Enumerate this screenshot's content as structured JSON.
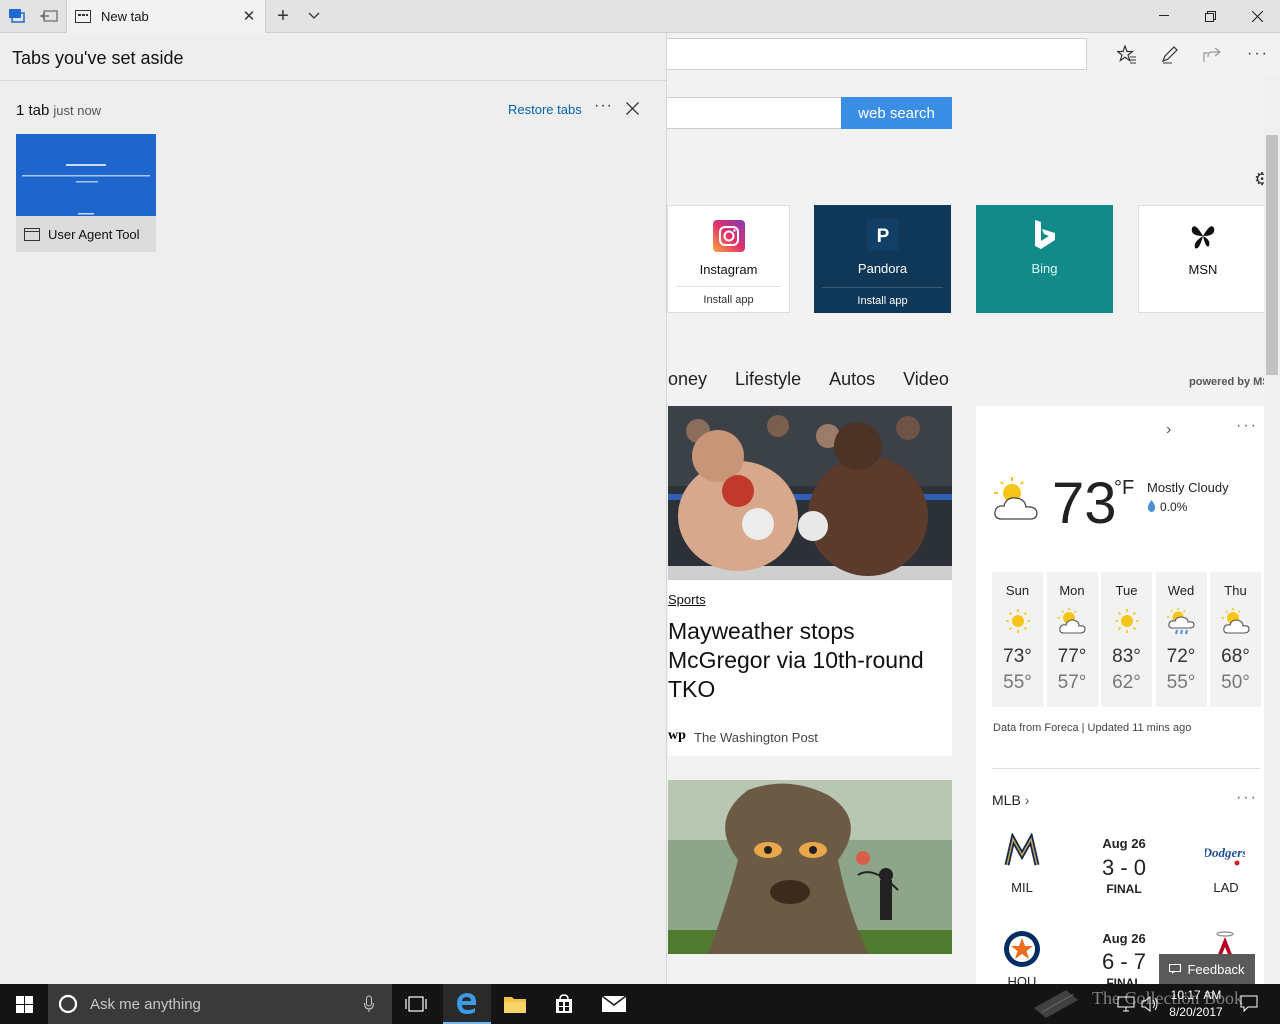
{
  "titlebar": {
    "tab_title": "New tab"
  },
  "aside": {
    "title": "Tabs you've set aside",
    "group_count": "1 tab",
    "group_time": "just now",
    "restore_label": "Restore tabs",
    "thumbnail_title": "User Agent Tool"
  },
  "page": {
    "search_button": "web search",
    "tiles": [
      {
        "name": "Instagram",
        "sub": "Install app",
        "icon": "instagram-icon",
        "bg": "#ffffff"
      },
      {
        "name": "Pandora",
        "sub": "Install app",
        "icon": "pandora-icon",
        "bg": "#0f3858"
      },
      {
        "name": "Bing",
        "sub": "",
        "icon": "bing-icon",
        "bg": "#138a8a"
      },
      {
        "name": "MSN",
        "sub": "",
        "icon": "msn-icon",
        "bg": "#ffffff"
      }
    ],
    "news_tabs": [
      "oney",
      "Lifestyle",
      "Autos",
      "Video"
    ],
    "powered_by": "powered by MS",
    "article": {
      "category": "Sports",
      "title": "Mayweather stops McGregor via 10th-round TKO",
      "source_logo": "wp",
      "source": "The Washington Post"
    },
    "weather": {
      "temp": "73",
      "unit": "°F",
      "condition": "Mostly Cloudy",
      "precip": "0.0%",
      "forecast": [
        {
          "day": "Sun",
          "hi": "73°",
          "lo": "55°",
          "icon": "sunny-icon"
        },
        {
          "day": "Mon",
          "hi": "77°",
          "lo": "57°",
          "icon": "partly-cloudy-icon"
        },
        {
          "day": "Tue",
          "hi": "83°",
          "lo": "62°",
          "icon": "sunny-icon"
        },
        {
          "day": "Wed",
          "hi": "72°",
          "lo": "55°",
          "icon": "rain-icon"
        },
        {
          "day": "Thu",
          "hi": "68°",
          "lo": "50°",
          "icon": "partly-cloudy-icon"
        }
      ],
      "credit": "Data from Foreca | Updated 11 mins ago"
    },
    "mlb": {
      "title": "MLB",
      "games": [
        {
          "date": "Aug 26",
          "score": "3 - 0",
          "status": "FINAL",
          "away": "MIL",
          "home": "LAD"
        },
        {
          "date": "Aug 26",
          "score": "6 - 7",
          "status": "FINAL",
          "away": "HOU",
          "home": ""
        }
      ]
    },
    "feedback_label": "Feedback"
  },
  "taskbar": {
    "search_placeholder": "Ask me anything",
    "time": "10:17 AM",
    "date": "8/20/2017",
    "watermark": "The Collection Book"
  },
  "colors": {
    "accent": "#3a8ee6",
    "link": "#0063b1",
    "pandora": "#0f3858",
    "bing": "#138a8a"
  }
}
